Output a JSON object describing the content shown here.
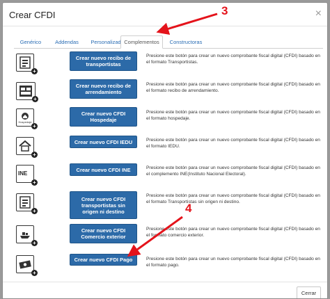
{
  "modal": {
    "title": "Crear CFDI",
    "close_symbol": "×"
  },
  "tabs": [
    {
      "label": "Genérico",
      "active": false
    },
    {
      "label": "Addendas",
      "active": false
    },
    {
      "label": "Personalizados",
      "active": false
    },
    {
      "label": "Complementos",
      "active": true
    },
    {
      "label": "Constructoras",
      "active": false
    }
  ],
  "rows": [
    {
      "icon": "transport-document-icon",
      "button": "Crear nuevo recibo de transportistas",
      "description": "Presione este botón para crear un nuevo comprobante fiscal digital (CFDI) basado en el formato Transportistas."
    },
    {
      "icon": "rental-document-icon",
      "button": "Crear nuevo recibo de arrendamiento",
      "description": "Presione este botón para crear un nuevo comprobante fiscal digital (CFDI) basado en el formato recibo de arrendamiento."
    },
    {
      "icon": "hospedaje-icon",
      "icon_text": "Hospedaje",
      "button": "Crear nuevo CFDI Hospedaje",
      "description": "Presione este botón para crear un nuevo comprobante fiscal digital (CFDI) basado en el formato hospedaje."
    },
    {
      "icon": "house-iedu-icon",
      "button": "Crear nuevo CFDI IEDU",
      "description": "Presione este botón para crear un nuevo comprobante fiscal digital (CFDI) basado en el formato IEDU."
    },
    {
      "icon": "ine-icon",
      "icon_text": "INE",
      "button": "Crear nuevo CFDI INE",
      "description": "Presione este botón para crear un nuevo comprobante fiscal digital (CFDI) basado en el complemento INE(Instituto Nacional Electoral)."
    },
    {
      "icon": "transport-document-icon",
      "button": "Crear nuevo CFDI transportistas sin origen ni destino",
      "description": "Presione este botón para crear un nuevo comprobante fiscal digital (CFDI) basado en el formato Transportistas sin origen ni destino."
    },
    {
      "icon": "ship-icon",
      "button": "Crear nuevo CFDI Comercio exterior",
      "description": "Presione este botón para crear un nuevo comprobante fiscal digital (CFDI) basado en el formato comercio exterior."
    },
    {
      "icon": "payment-icon",
      "button": "Crear nuevo CFDI Pago",
      "description": "Presione este botón para crear un nuevo comprobante fiscal digital (CFDI) basado en el formato pago."
    }
  ],
  "footer": {
    "close_label": "Cerrar"
  },
  "annotations": {
    "step_3": "3",
    "step_4": "4",
    "color": "#e4131b"
  }
}
